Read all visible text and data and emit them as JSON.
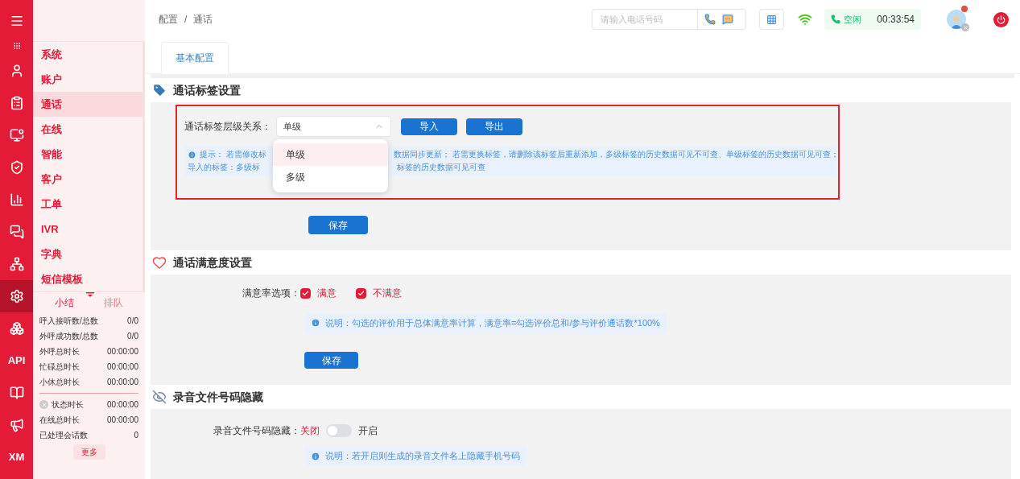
{
  "nav_rail": [
    {
      "selected": false
    },
    {
      "selected": false
    },
    {
      "selected": false
    },
    {
      "selected": false
    },
    {
      "selected": false
    },
    {
      "selected": false
    },
    {
      "selected": false
    },
    {
      "selected": false
    },
    {
      "selected": false
    },
    {
      "selected": true
    },
    {
      "selected": false
    },
    {
      "label": "API",
      "selected": false
    },
    {
      "selected": false
    },
    {
      "selected": false
    },
    {
      "label": "XM",
      "selected": false
    }
  ],
  "menu": [
    {
      "label": "系统",
      "selected": false
    },
    {
      "label": "账户",
      "selected": false
    },
    {
      "label": "通话",
      "selected": true
    },
    {
      "label": "在线",
      "selected": false
    },
    {
      "label": "智能",
      "selected": false
    },
    {
      "label": "客户",
      "selected": false
    },
    {
      "label": "工单",
      "selected": false
    },
    {
      "label": "IVR",
      "selected": false
    },
    {
      "label": "字典",
      "selected": false
    },
    {
      "label": "短信模板",
      "selected": false
    }
  ],
  "stats": {
    "tabs": [
      {
        "label": "小结",
        "selected": true
      },
      {
        "label": "排队",
        "selected": false
      }
    ],
    "rows": [
      {
        "label": "呼入接听数/总数",
        "value": "0/0"
      },
      {
        "label": "外呼成功数/总数",
        "value": "0/0"
      },
      {
        "label": "外呼总时长",
        "value": "00:00:00"
      },
      {
        "label": "忙碌总时长",
        "value": "00:00:00"
      },
      {
        "label": "小休总时长",
        "value": "00:00:00"
      }
    ],
    "rows_2": [
      {
        "label": "状态时长",
        "value": "00:00:00",
        "kind": "status"
      },
      {
        "label": "在线总时长",
        "value": "00:00:00",
        "kind": "plain"
      },
      {
        "label": "已处理会话数",
        "value": "0",
        "kind": "plain"
      }
    ],
    "more_button": "更多"
  },
  "breadcrumb": [
    "配置",
    "/",
    "通话"
  ],
  "top_bar": {
    "phone_placeholder": "请输入电话号码",
    "status": "空闲",
    "timer": "00:33:54",
    "has_notification": true
  },
  "tabs": [
    {
      "label": "基本配置",
      "selected": true
    }
  ],
  "tag_section": {
    "title": "通话标签设置",
    "field_label": "通话标签层级关系：",
    "select_value": "单级",
    "expanded": true,
    "buttons": [
      "导入",
      "导出"
    ],
    "hint_lines": [
      {
        "left": "提示：  若需修改标",
        "right": "数据同步更新；  若需更换标签，请删除该标签后重新添加，多级标签的历史数据可见不可查、单级标签的历史数据可见可查；"
      },
      {
        "left": "导入的标签：多级标",
        "right": "标签的历史数据可见可查"
      }
    ],
    "options": [
      {
        "label": "单级",
        "selected": true
      },
      {
        "label": "多级",
        "selected": false
      }
    ],
    "save": "保存"
  },
  "satisfaction_section": {
    "title": "通话满意度设置",
    "field_label": "满意率选项：",
    "options": [
      {
        "label": "满意",
        "checked": true
      },
      {
        "label": "不满意",
        "checked": true
      }
    ],
    "hint": "说明：勾选的评价用于总体满意率计算，满意率=勾选评价总和/参与评价通话数*100%",
    "save": "保存"
  },
  "recording_section": {
    "title": "录音文件号码隐藏",
    "field_label": "录音文件号码隐藏：",
    "off_label": "关闭",
    "on_label": "开启",
    "on": false,
    "hint": "说明：若开启则生成的录音文件名上隐藏手机号码"
  }
}
